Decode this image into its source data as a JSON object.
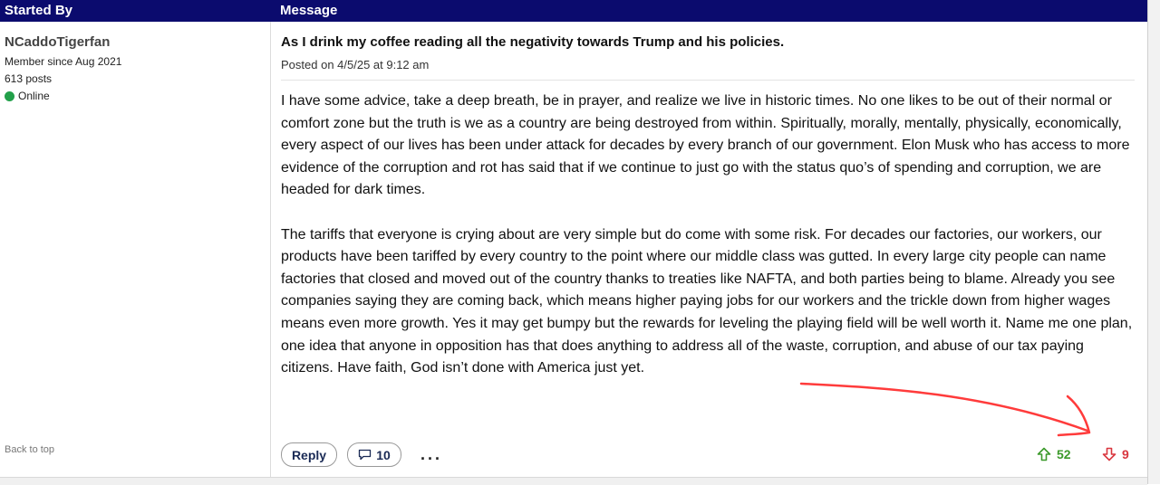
{
  "header": {
    "started_by": "Started By",
    "message": "Message"
  },
  "author": {
    "name": "NCaddoTigerfan",
    "member_since": "Member since Aug 2021",
    "posts": "613 posts",
    "status": "Online"
  },
  "back_to_top": "Back to top",
  "post": {
    "title": "As I drink my coffee reading all the negativity towards Trump and his policies.",
    "date": "Posted on 4/5/25 at 9:12 am",
    "paragraphs": [
      "I have some advice, take a deep breath, be in prayer, and realize we live in historic times. No one likes to be out of their normal or comfort zone but the truth is we as a country are being destroyed from within. Spiritually, morally, mentally, physically, economically, every aspect of our lives has been under attack for decades by every branch of our government. Elon Musk who has access to more evidence of the corruption and rot has said that if we continue to just go with the status quo’s of spending and corruption, we are headed for dark times.",
      "The tariffs that everyone is crying about are very simple but do come with some risk. For decades our factories, our workers, our products have been tariffed by every country to the point where our middle class was gutted. In every large city people can name factories that closed and moved out of the country thanks to treaties like NAFTA, and both parties being to blame. Already you see companies saying they are coming back, which means higher paying jobs for our workers and the trickle down from higher wages means even more growth. Yes it may get bumpy but the rewards for leveling the playing field will be well worth it. Name me one plan, one idea that anyone in opposition has that does anything to address all of the waste, corruption, and abuse of our tax paying citizens. Have faith, God isn’t done with America just yet."
    ]
  },
  "actions": {
    "reply": "Reply",
    "comments": "10",
    "more": "...",
    "upvotes": "52",
    "downvotes": "9"
  },
  "colors": {
    "header_bg": "#0b0b6e",
    "online": "#22a04a",
    "upvote": "#3c9a2b",
    "downvote": "#d9363e",
    "annotation_arrow": "#ff3b3b"
  }
}
